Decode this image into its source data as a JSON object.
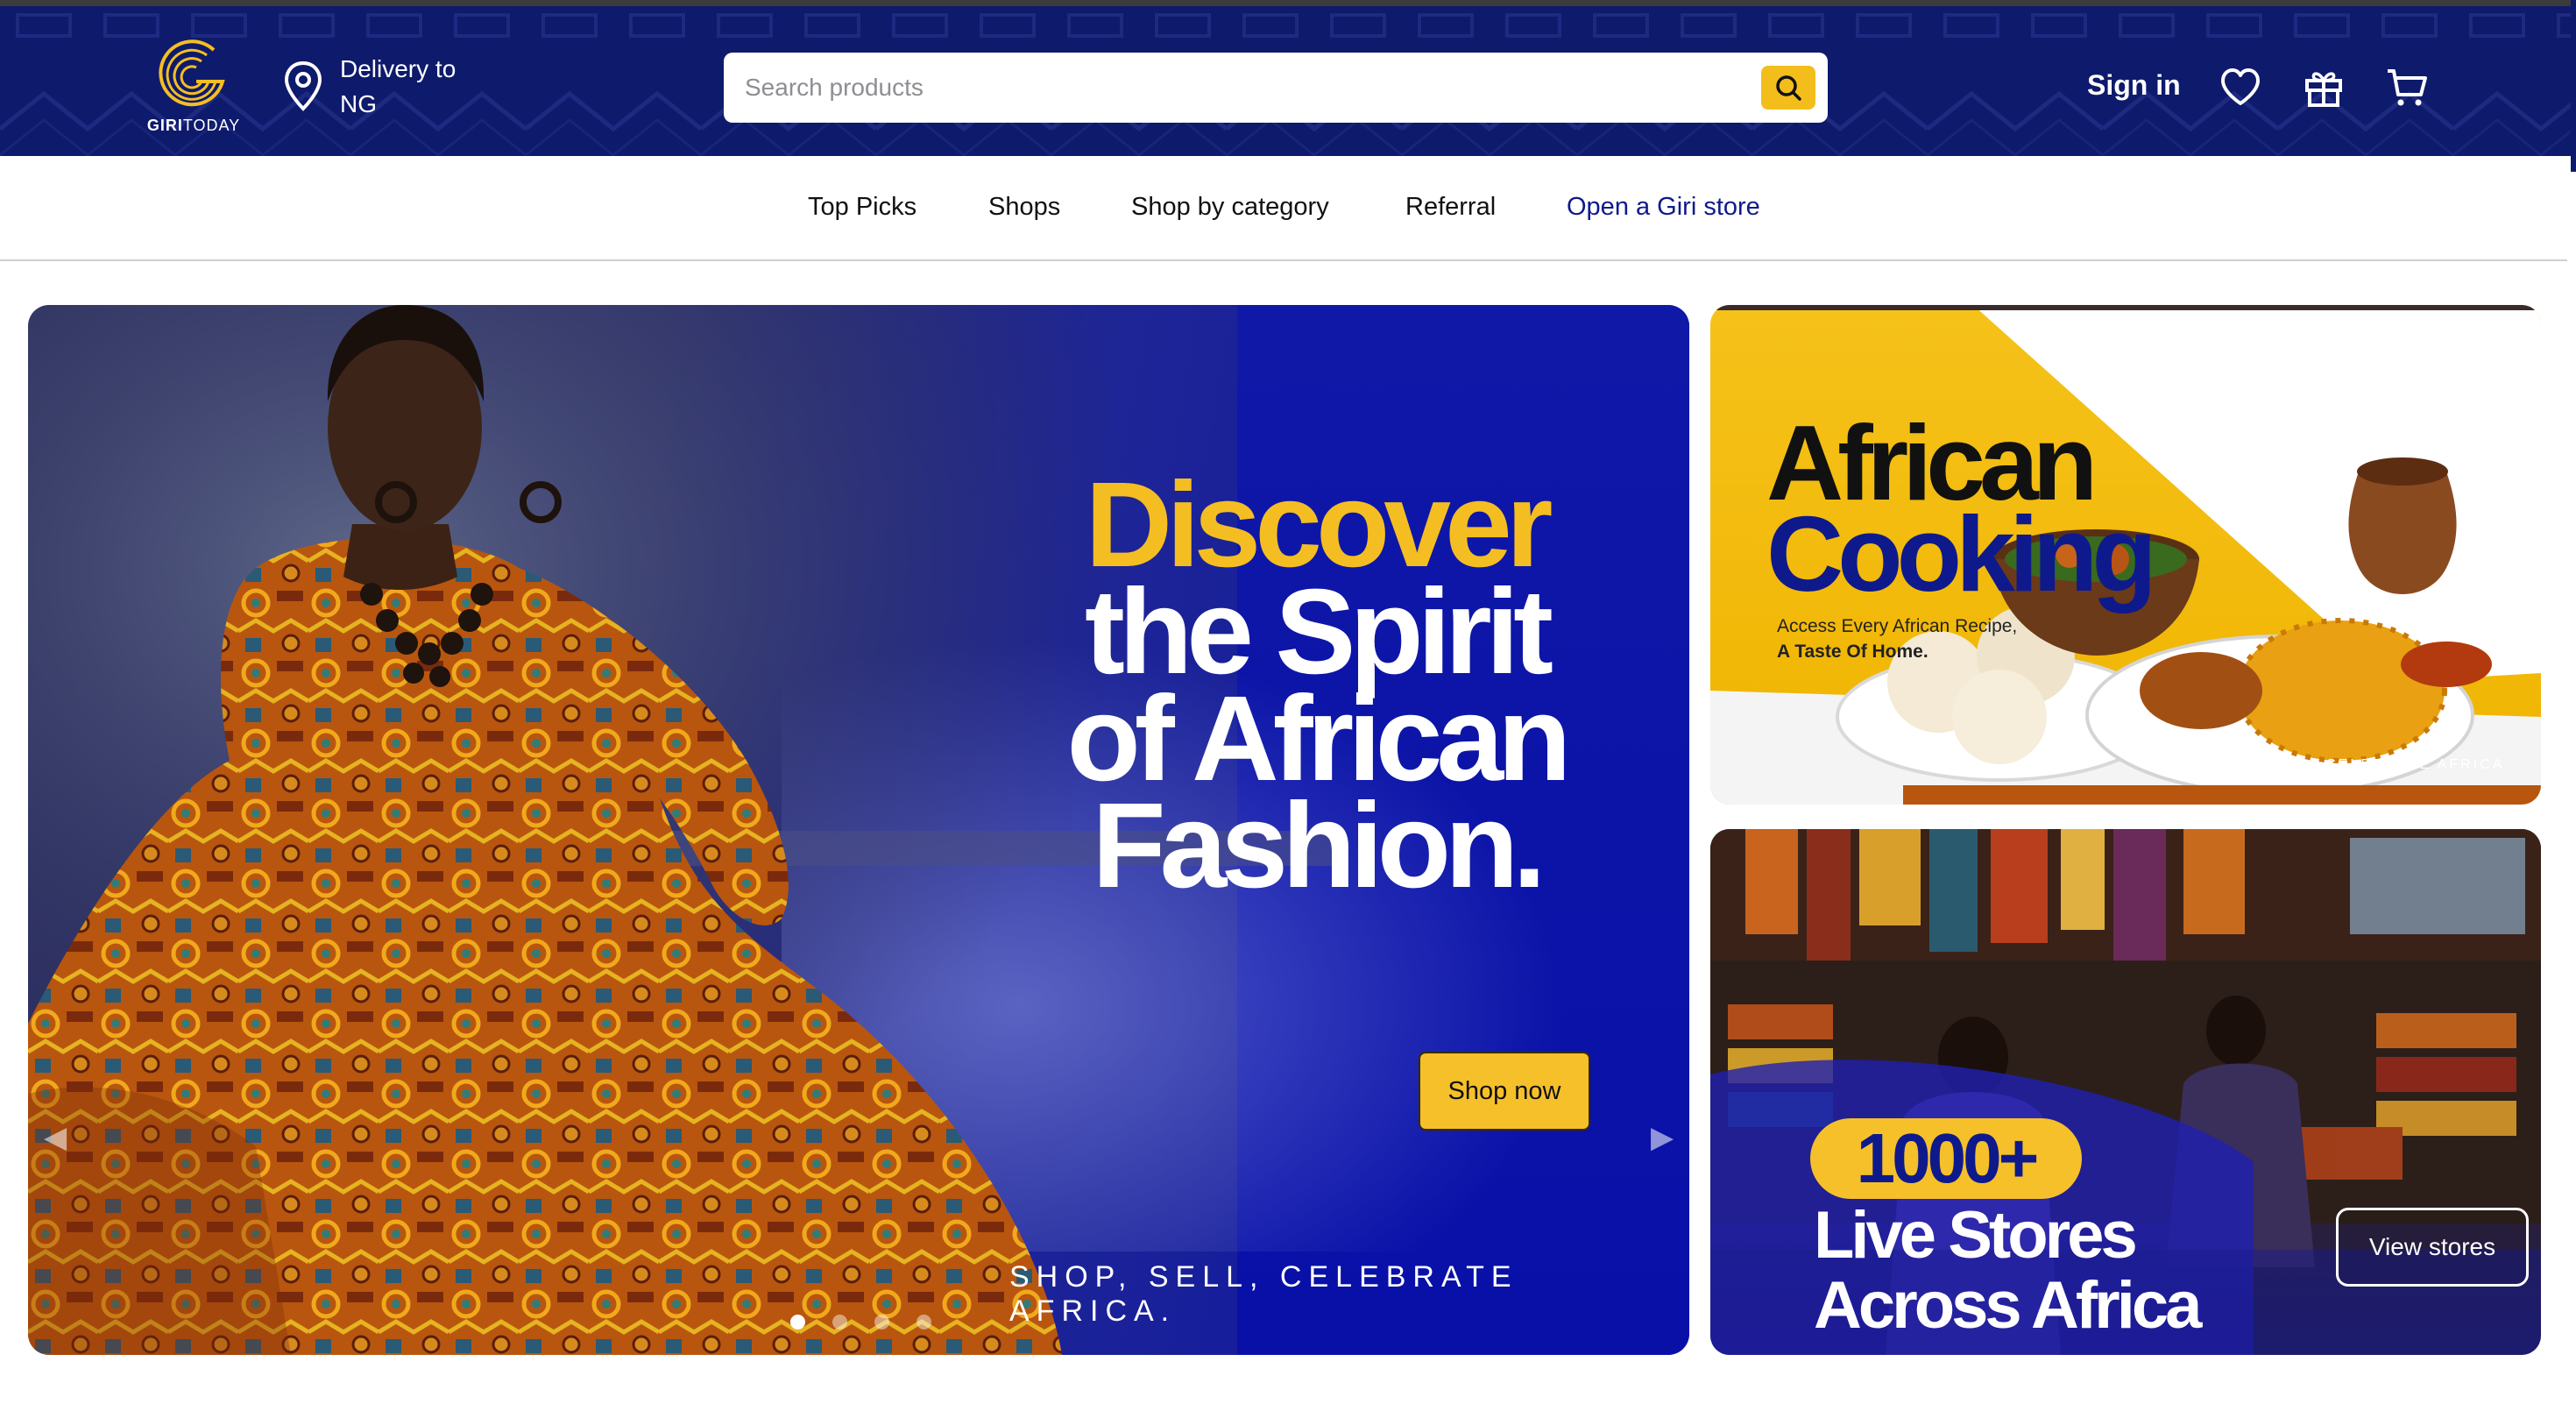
{
  "header": {
    "logo_brand_bold": "GIRI",
    "logo_brand_light": "TODAY",
    "delivery_label": "Delivery to",
    "delivery_country": "NG",
    "search_placeholder": "Search products",
    "signin_label": "Sign in",
    "icons": [
      "location-pin-icon",
      "search-icon",
      "heart-icon",
      "gift-icon",
      "cart-icon"
    ]
  },
  "nav": {
    "items": [
      {
        "label": "Top Picks"
      },
      {
        "label": "Shops"
      },
      {
        "label": "Shop by category"
      },
      {
        "label": "Referral"
      },
      {
        "label": "Open a Giri store"
      }
    ]
  },
  "hero": {
    "title_gold": "Discover",
    "title_line2": "the Spirit",
    "title_line3": "of African",
    "title_line4": "Fashion.",
    "cta_label": "Shop now",
    "tagline": "SHOP, SELL, CELEBRATE AFRICA.",
    "carousel_total": 4,
    "carousel_active": 1
  },
  "cooking_card": {
    "title_line1": "African",
    "title_line2": "Cooking",
    "sub_line1": "Access Every African Recipe,",
    "sub_line2": "A Taste Of Home.",
    "tagline": "SHOP, SELL, CELEBRATE AFRICA."
  },
  "stores_card": {
    "count": "1000+",
    "line1": "Live Stores",
    "line2": "Across Africa",
    "cta_label": "View stores"
  },
  "colors": {
    "brand_navy": "#0e1a6b",
    "accent_gold": "#f4be22",
    "accent_blue": "#0e1a8c"
  }
}
